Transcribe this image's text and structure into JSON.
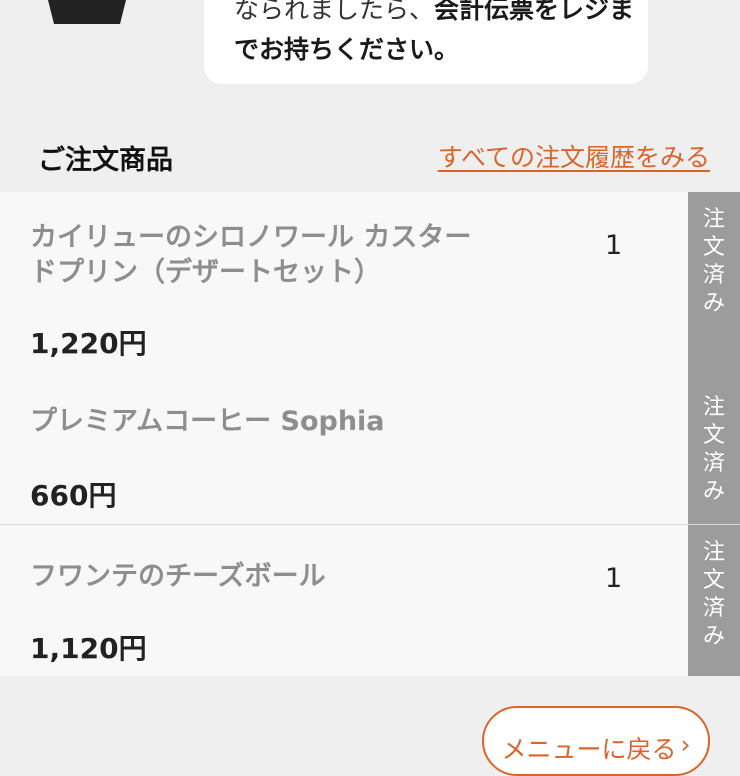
{
  "message": {
    "line1_normal": "なられましたら、",
    "line1_bold": "会計伝票をレジま",
    "line2": "でお持ちください。"
  },
  "section": {
    "title": "ご注文商品",
    "history_link": "すべての注文履歴をみる"
  },
  "orders": [
    {
      "name": "カイリューのシロノワール カスタードプリン（デザートセット）",
      "quantity": "1",
      "price": "1,220円",
      "status": [
        "注",
        "文",
        "済",
        "み"
      ]
    },
    {
      "name": "プレミアムコーヒー Sophia",
      "quantity": "",
      "price": "660円",
      "status": [
        "注",
        "文",
        "済",
        "み"
      ]
    },
    {
      "name": "フワンテのチーズボール",
      "quantity": "1",
      "price": "1,120円",
      "status": [
        "注",
        "文",
        "済",
        "み"
      ]
    }
  ],
  "back_button": {
    "label": "メニューに戻る"
  },
  "colors": {
    "accent": "#d9652a",
    "status_bg": "#9c9c9c"
  }
}
